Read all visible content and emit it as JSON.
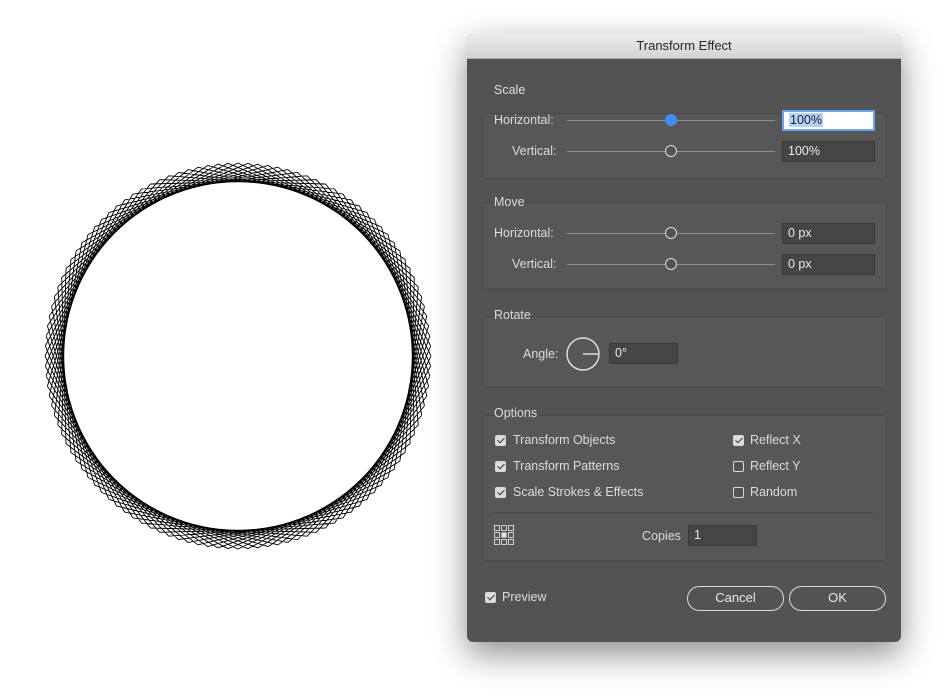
{
  "dialog": {
    "title": "Transform Effect",
    "scale": {
      "label": "Scale",
      "horizontal_label": "Horizontal:",
      "horizontal_value": "100%",
      "vertical_label": "Vertical:",
      "vertical_value": "100%"
    },
    "move": {
      "label": "Move",
      "horizontal_label": "Horizontal:",
      "horizontal_value": "0 px",
      "vertical_label": "Vertical:",
      "vertical_value": "0 px"
    },
    "rotate": {
      "label": "Rotate",
      "angle_label": "Angle:",
      "angle_value": "0°"
    },
    "options": {
      "label": "Options",
      "transform_objects": "Transform Objects",
      "transform_patterns": "Transform Patterns",
      "scale_strokes": "Scale Strokes & Effects",
      "reflect_x": "Reflect X",
      "reflect_y": "Reflect Y",
      "random": "Random",
      "copies_label": "Copies",
      "copies_value": "1"
    },
    "preview_label": "Preview",
    "cancel_label": "Cancel",
    "ok_label": "OK"
  },
  "colors": {
    "dialog_bg": "#535353",
    "accent": "#3d8ef5",
    "artwork": "#000000"
  }
}
